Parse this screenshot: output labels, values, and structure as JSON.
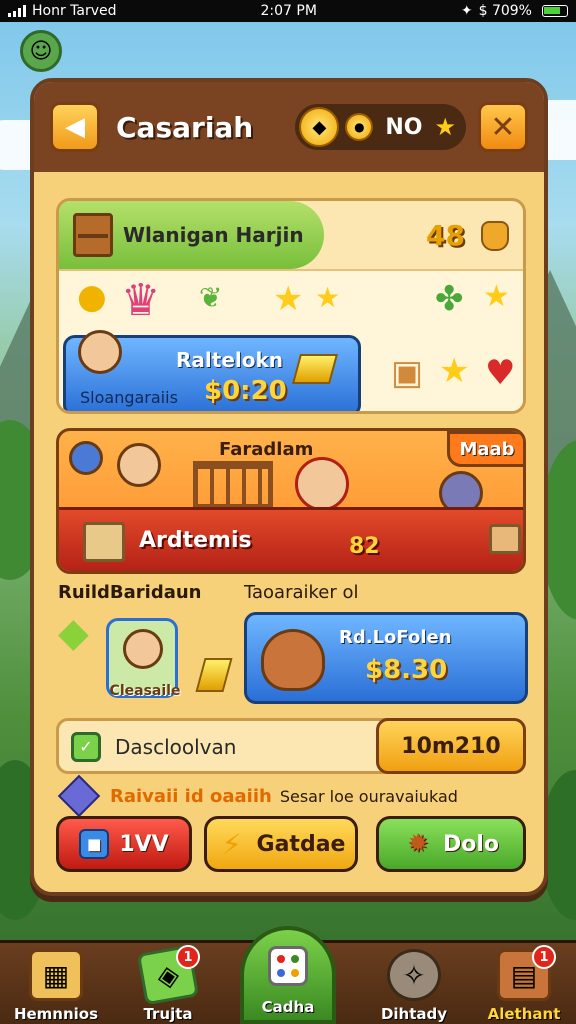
{
  "status_bar": {
    "carrier": "Honr Tarved",
    "time": "2:07 PM",
    "battery_text": "$ 709%"
  },
  "header": {
    "title": "Casariah",
    "resource_text": "NO"
  },
  "featured": {
    "head_label": "Wlanigan Harjin",
    "count": "48",
    "card_name": "Raltelokn",
    "card_price": "$0:20",
    "card_sub": "Sloangaraiis"
  },
  "event": {
    "tag": "Faradlam",
    "corner": "Maab",
    "band_name": "Ardtemis",
    "band_number": "82"
  },
  "labels": {
    "left": "RuildBaridaun",
    "right": "Taoaraiker ol",
    "portrait_caption": "Cleasaile"
  },
  "offer": {
    "name": "Rd.LoFolen",
    "price": "$8.30"
  },
  "option_row": {
    "label": "Dascloolvan",
    "timer": "10m210"
  },
  "reward_row": {
    "highlight": "Raivaii id oaaiih",
    "note": "Sesar loe ouravaiukad"
  },
  "buttons": {
    "red": "1VV",
    "yellow": "Gatdae",
    "green": "Dolo"
  },
  "nav": {
    "items": [
      {
        "label": "Hemnnios",
        "badge": ""
      },
      {
        "label": "Trujta",
        "badge": "1"
      },
      {
        "label": "Cadha",
        "badge": ""
      },
      {
        "label": "Dihtady",
        "badge": ""
      },
      {
        "label": "Alethant",
        "badge": "1"
      }
    ]
  },
  "colors": {
    "panel": "#f7d07a",
    "header": "#7a4321",
    "accent_gold": "#ffd53a",
    "blue_card": "#2a6fd6",
    "red_band": "#b01e14",
    "green_button": "#5cbf2a"
  }
}
